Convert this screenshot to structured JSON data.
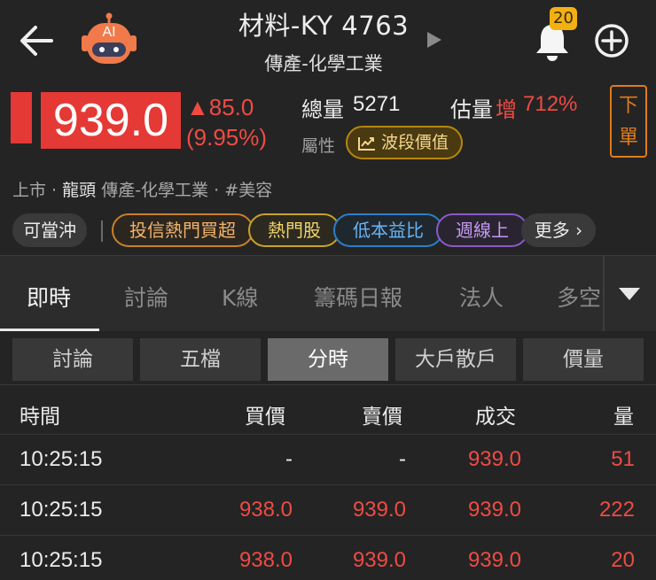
{
  "header": {
    "title": "材料-KY 4763",
    "subtitle": "傳產-化學工業",
    "robot_label": "AI",
    "notification_count": "20"
  },
  "quote": {
    "price": "939.0",
    "change": "▲85.0",
    "change_pct": "(9.95%)",
    "volume_label": "總量",
    "volume_value": "5271",
    "est_label": "估量",
    "est_dir": "增",
    "est_value": "712%",
    "attr_label": "屬性",
    "wave_button": "波段價值",
    "order_button_line1": "下",
    "order_button_line2": "單",
    "colors": {
      "up": "#e53935",
      "accent_orange": "#e07b1a"
    }
  },
  "tags": {
    "market": "上市",
    "leader": "龍頭",
    "industry": "傳產-化學工業",
    "theme": "#美容"
  },
  "chips": [
    {
      "label": "可當沖",
      "style": "plain"
    },
    {
      "label": "投信熱門買超",
      "style": "orange"
    },
    {
      "label": "熱門股",
      "style": "gold"
    },
    {
      "label": "低本益比",
      "style": "blue"
    },
    {
      "label": "週線上",
      "style": "purple"
    },
    {
      "label": "更多 ›",
      "style": "plain"
    }
  ],
  "main_tabs": [
    "即時",
    "討論",
    "K線",
    "籌碼日報",
    "法人",
    "多空"
  ],
  "main_tab_active": "即時",
  "sub_tabs": [
    "討論",
    "五檔",
    "分時",
    "大戶散戶",
    "價量"
  ],
  "sub_tab_active": "分時",
  "table": {
    "columns": [
      "時間",
      "買價",
      "賣價",
      "成交",
      "量"
    ],
    "rows": [
      [
        "10:25:15",
        "-",
        "-",
        "939.0",
        "51"
      ],
      [
        "10:25:15",
        "938.0",
        "939.0",
        "939.0",
        "222"
      ],
      [
        "10:25:15",
        "938.0",
        "939.0",
        "939.0",
        "20"
      ]
    ]
  }
}
